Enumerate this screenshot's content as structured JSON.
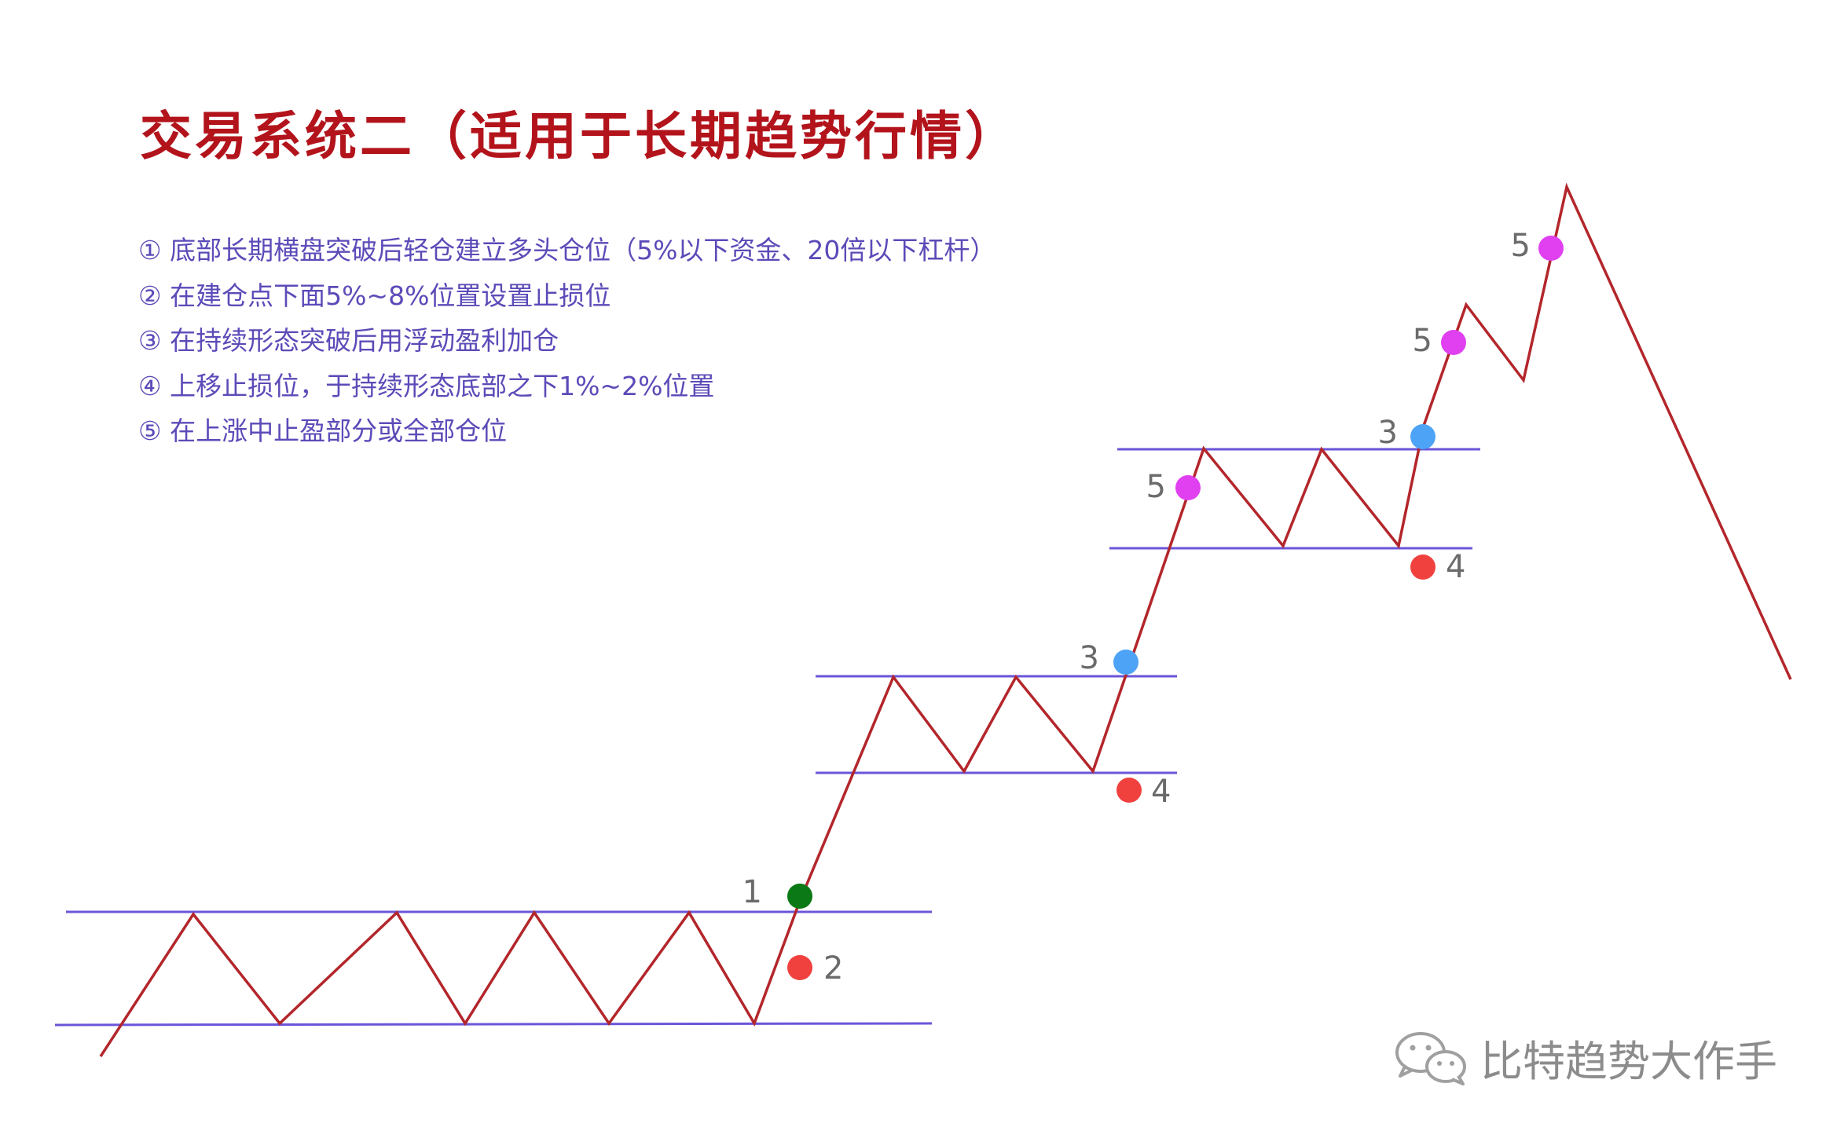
{
  "title": "交易系统二（适用于长期趋势行情）",
  "rules": [
    "① 底部长期横盘突破后轻仓建立多头仓位（5%以下资金、20倍以下杠杆）",
    "② 在建仓点下面5%~8%位置设置止损位",
    "③ 在持续形态突破后用浮动盈利加仓",
    "④ 上移止损位，于持续形态底部之下1%~2%位置",
    "⑤ 在上涨中止盈部分或全部仓位"
  ],
  "points": [
    {
      "label": "1",
      "color": "#0b7a16",
      "meaning": "entry"
    },
    {
      "label": "2",
      "color": "#f0413f",
      "meaning": "stop-loss"
    },
    {
      "label": "3",
      "color": "#4da3f5",
      "meaning": "add-position"
    },
    {
      "label": "4",
      "color": "#f0413f",
      "meaning": "raise-stop-loss"
    },
    {
      "label": "3",
      "color": "#4da3f5",
      "meaning": "add-position"
    },
    {
      "label": "4",
      "color": "#f0413f",
      "meaning": "raise-stop-loss"
    },
    {
      "label": "5",
      "color": "#e040f0",
      "meaning": "take-profit"
    },
    {
      "label": "5",
      "color": "#e040f0",
      "meaning": "take-profit"
    },
    {
      "label": "5",
      "color": "#e040f0",
      "meaning": "take-profit"
    }
  ],
  "colors": {
    "price_line": "#b3262b",
    "channel_line": "#6b55d9",
    "title": "#b3141c",
    "rules_text": "#5b4bb8"
  },
  "icons": {
    "watermark_logo": "wechat-icon"
  },
  "watermark": "比特趋势大作手"
}
